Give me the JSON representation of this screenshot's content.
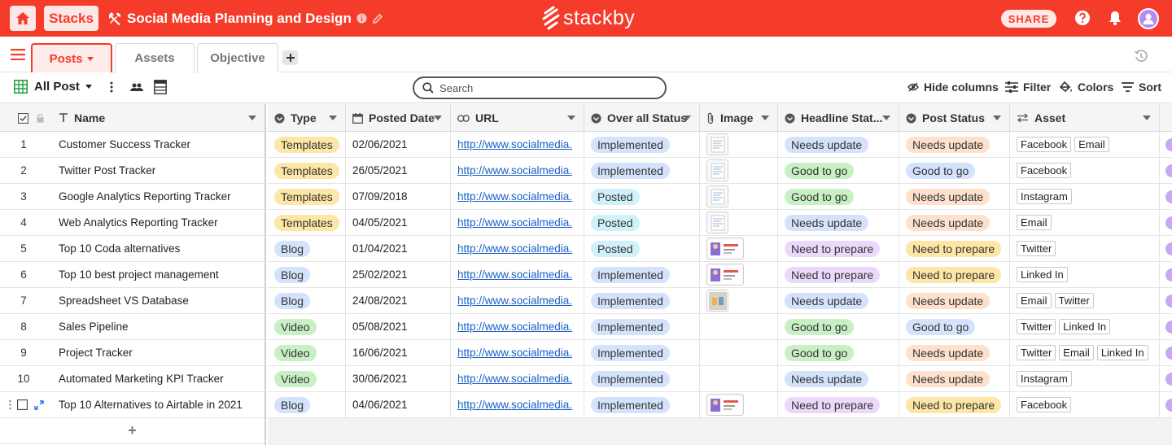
{
  "topbar": {
    "stacks_label": "Stacks",
    "title": "Social Media Planning and Design",
    "logo_text": "stackby",
    "share_label": "SHARE",
    "brand_color": "#f53b29"
  },
  "tabs": [
    {
      "label": "Posts",
      "active": true
    },
    {
      "label": "Assets",
      "active": false
    },
    {
      "label": "Objective",
      "active": false
    }
  ],
  "toolbar": {
    "view_label": "All Post",
    "search_placeholder": "Search",
    "hide_columns": "Hide columns",
    "filter": "Filter",
    "colors": "Colors",
    "sort": "Sort"
  },
  "columns": {
    "name": "Name",
    "type": "Type",
    "posted_date": "Posted Date",
    "url": "URL",
    "overall_status": "Over all Status",
    "image": "Image",
    "headline_status": "Headline Stat...",
    "post_status": "Post Status",
    "asset": "Asset"
  },
  "rows": [
    {
      "num": "1",
      "name": "Customer Success Tracker",
      "type": "Templates",
      "date": "02/06/2021",
      "url": "http://www.socialmedia.",
      "overall": "Implemented",
      "image": "doc",
      "headline": "Needs update",
      "post": "Needs update",
      "assets": [
        "Facebook",
        "Email"
      ]
    },
    {
      "num": "2",
      "name": "Twitter Post Tracker",
      "type": "Templates",
      "date": "26/05/2021",
      "url": "http://www.socialmedia.",
      "overall": "Implemented",
      "image": "doc",
      "headline": "Good to go",
      "post": "Good to go",
      "assets": [
        "Facebook"
      ]
    },
    {
      "num": "3",
      "name": "Google Analytics Reporting Tracker",
      "type": "Templates",
      "date": "07/09/2018",
      "url": "http://www.socialmedia.",
      "overall": "Posted",
      "image": "doc",
      "headline": "Good to go",
      "post": "Needs update",
      "assets": [
        "Instagram"
      ]
    },
    {
      "num": "4",
      "name": "Web Analytics Reporting Tracker",
      "type": "Templates",
      "date": "04/05/2021",
      "url": "http://www.socialmedia.",
      "overall": "Posted",
      "image": "doc",
      "headline": "Needs update",
      "post": "Needs update",
      "assets": [
        "Email"
      ]
    },
    {
      "num": "5",
      "name": "Top 10 Coda alternatives",
      "type": "Blog",
      "date": "01/04/2021",
      "url": "http://www.socialmedia.",
      "overall": "Posted",
      "image": "banner",
      "headline": "Need to prepare",
      "post": "Need to prepare",
      "assets": [
        "Twitter"
      ]
    },
    {
      "num": "6",
      "name": "Top 10 best project management",
      "type": "Blog",
      "date": "25/02/2021",
      "url": "http://www.socialmedia.",
      "overall": "Implemented",
      "image": "banner",
      "headline": "Need to prepare",
      "post": "Need to prepare",
      "assets": [
        "Linked In"
      ]
    },
    {
      "num": "7",
      "name": "Spreadsheet VS Database",
      "type": "Blog",
      "date": "24/08/2021",
      "url": "http://www.socialmedia.",
      "overall": "Implemented",
      "image": "square",
      "headline": "Needs update",
      "post": "Needs update",
      "assets": [
        "Email",
        "Twitter"
      ]
    },
    {
      "num": "8",
      "name": "Sales Pipeline",
      "type": "Video",
      "date": "05/08/2021",
      "url": "http://www.socialmedia.",
      "overall": "Implemented",
      "image": "",
      "headline": "Good to go",
      "post": "Good to go",
      "assets": [
        "Twitter",
        "Linked In"
      ]
    },
    {
      "num": "9",
      "name": "Project Tracker",
      "type": "Video",
      "date": "16/06/2021",
      "url": "http://www.socialmedia.",
      "overall": "Implemented",
      "image": "",
      "headline": "Good to go",
      "post": "Needs update",
      "assets": [
        "Twitter",
        "Email",
        "Linked In"
      ]
    },
    {
      "num": "10",
      "name": "Automated Marketing KPI Tracker",
      "type": "Video",
      "date": "30/06/2021",
      "url": "http://www.socialmedia.",
      "overall": "Implemented",
      "image": "",
      "headline": "Needs update",
      "post": "Needs update",
      "assets": [
        "Instagram"
      ]
    },
    {
      "num": "",
      "name": "Top 10 Alternatives to Airtable in 2021",
      "type": "Blog",
      "date": "04/06/2021",
      "url": "http://www.socialmedia.",
      "overall": "Implemented",
      "image": "banner",
      "headline": "Need to prepare",
      "post": "Need to prepare",
      "assets": [
        "Facebook"
      ]
    }
  ],
  "pill_colors": {
    "Templates": "#fde7a6",
    "Blog": "#d4e3fb",
    "Video": "#c9f0c4",
    "Implemented": "#d4e3fb",
    "Posted": "#cff1f9",
    "Needs update_headline": "#d4e3fb",
    "Good to go_headline": "#c9f0c4",
    "Need to prepare_headline": "#ead9fb",
    "Needs update_post": "#fde1cc",
    "Good to go_post": "#d4e3fb",
    "Need to prepare_post": "#fde7a6"
  },
  "add_row_label": "+"
}
